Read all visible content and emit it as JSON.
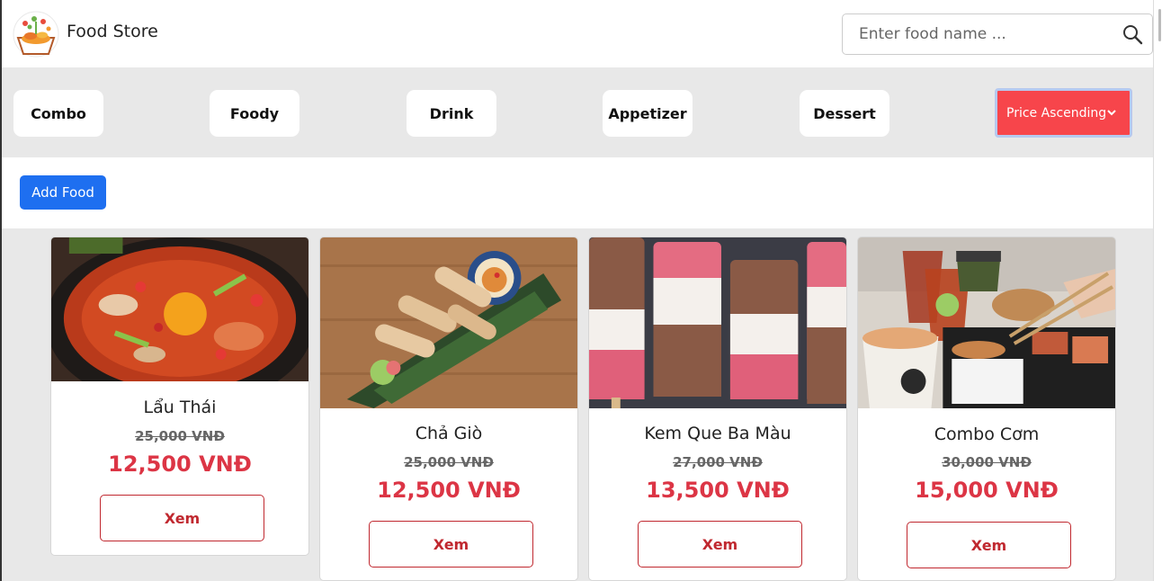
{
  "header": {
    "brand": "Food Store",
    "logo_icon": "food-basket-logo",
    "search_placeholder": "Enter food name ...",
    "search_icon": "search-icon"
  },
  "categories": [
    "Combo",
    "Foody",
    "Drink",
    "Appetizer",
    "Dessert"
  ],
  "sort": {
    "label": "Price Ascending",
    "color": "#f7454b"
  },
  "toolbar": {
    "add_label": "Add Food",
    "add_color": "#1e6ff0"
  },
  "products": [
    {
      "name": "Lẩu Thái",
      "old_price": "25,000 VNĐ",
      "price": "12,500 VNĐ",
      "button": "Xem"
    },
    {
      "name": "Chả Giò",
      "old_price": "25,000 VNĐ",
      "price": "12,500 VNĐ",
      "button": "Xem"
    },
    {
      "name": "Kem Que Ba Màu",
      "old_price": "27,000 VNĐ",
      "price": "13,500 VNĐ",
      "button": "Xem"
    },
    {
      "name": "Combo Cơm",
      "old_price": "30,000 VNĐ",
      "price": "15,000 VNĐ",
      "button": "Xem"
    }
  ],
  "colors": {
    "price": "#dc3545",
    "accent_border": "#c0282f"
  }
}
